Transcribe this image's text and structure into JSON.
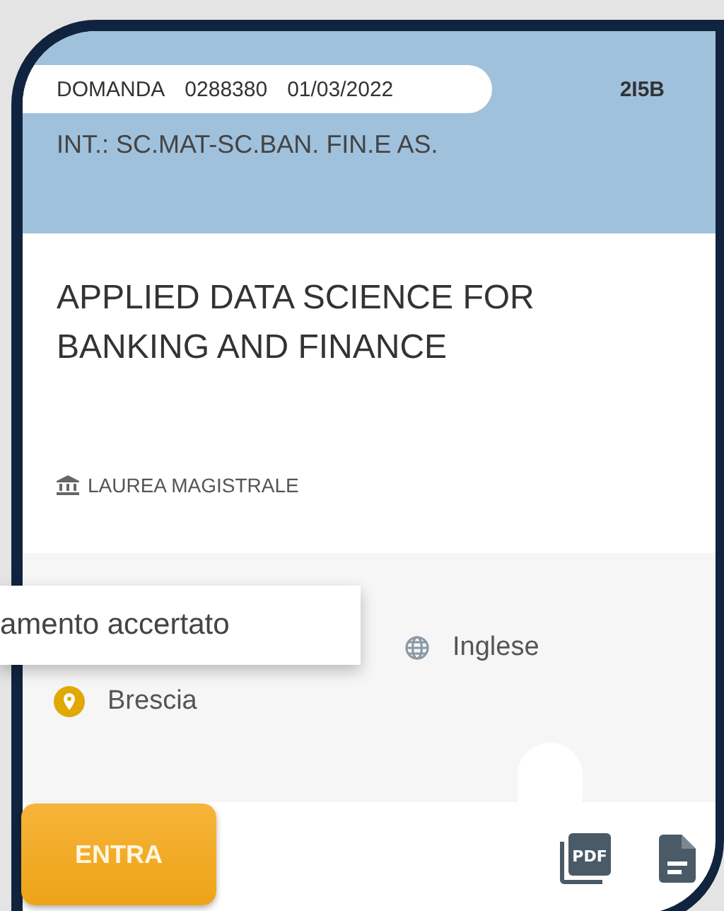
{
  "header": {
    "domanda_label": "DOMANDA",
    "domanda_number": "0288380",
    "domanda_date": "01/03/2022",
    "code": "2I5B",
    "interest": "INT.: SC.MAT-SC.BAN. FIN.E AS."
  },
  "course": {
    "title": "APPLIED DATA SCIENCE FOR BANKING AND FINANCE",
    "degree": "LAUREA MAGISTRALE"
  },
  "details": {
    "language": "Inglese",
    "location": "Brescia"
  },
  "tooltip": {
    "text": "amento accertato"
  },
  "actions": {
    "enter_button": "ENTRA",
    "pdf_icon_label": "PDF"
  }
}
